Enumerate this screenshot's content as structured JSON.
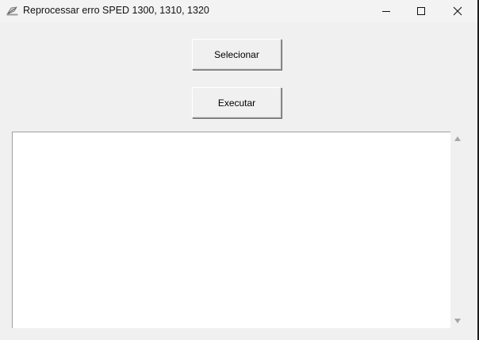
{
  "window": {
    "title": "Reprocessar erro SPED 1300, 1310, 1320"
  },
  "buttons": {
    "select_label": "Selecionar",
    "execute_label": "Executar"
  },
  "output": {
    "value": ""
  },
  "icons": {
    "app": "feather-app-icon",
    "minimize": "minimize-icon",
    "maximize": "maximize-icon",
    "close": "close-icon",
    "scroll_up": "scroll-up-arrow-icon",
    "scroll_down": "scroll-down-arrow-icon"
  }
}
